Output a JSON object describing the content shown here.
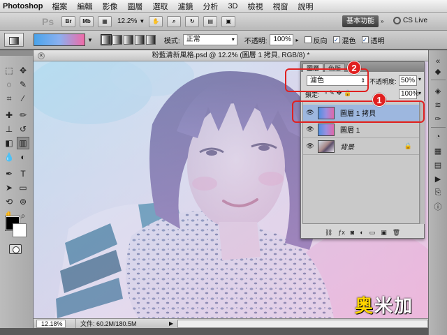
{
  "menubar": {
    "app_name": "Photoshop",
    "items": [
      "檔案",
      "編輯",
      "影像",
      "圖層",
      "選取",
      "濾鏡",
      "分析",
      "3D",
      "檢視",
      "視窗",
      "說明"
    ]
  },
  "appbar": {
    "ps_logo": "Ps",
    "br": "Br",
    "mb": "Mb",
    "zoom": "12.2%",
    "workspace": "基本功能",
    "cslive": "CS Live"
  },
  "options": {
    "mode_label": "模式:",
    "mode_value": "正常",
    "opacity_label": "不透明:",
    "opacity_value": "100%",
    "reverse_label": "反向",
    "dither_label": "混色",
    "transparency_label": "透明",
    "reverse_checked": false,
    "dither_checked": true,
    "transparency_checked": true
  },
  "document": {
    "title": "粉藍清新風格.psd @ 12.2% (圖層 1 拷貝, RGB/8) *",
    "status_zoom": "12.18%",
    "status_info": "文件: 60.2M/180.5M"
  },
  "layers_panel": {
    "tabs": [
      "圖層",
      "色版"
    ],
    "blend_mode": "濾色",
    "opacity_label": "不透明度:",
    "opacity_value": "50%",
    "lock_label": "鎖定:",
    "fill_value": "100%",
    "layers": [
      {
        "name": "圖層 1 拷貝",
        "selected": true,
        "thumb": "gradient"
      },
      {
        "name": "圖層 1",
        "selected": false,
        "thumb": "gradient"
      },
      {
        "name": "背景",
        "selected": false,
        "thumb": "photo",
        "locked": true
      }
    ]
  },
  "annotations": {
    "badge_1": "1",
    "badge_2": "2",
    "color": "#e02020"
  },
  "watermark": {
    "first": "奥",
    "rest": "米加"
  },
  "colors": {
    "gradient_start": "#4aa3ea",
    "gradient_end": "#f06aa6",
    "foreground": "#000000",
    "background": "#ffffff"
  }
}
